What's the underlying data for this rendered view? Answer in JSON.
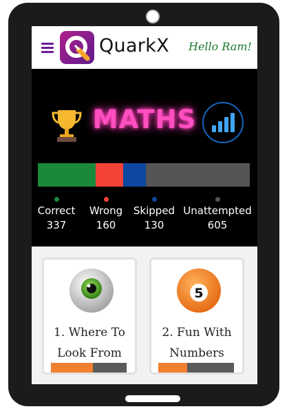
{
  "app": {
    "brand": "QuarkX",
    "greeting": "Hello Ram!",
    "menu_icon": "hamburger-menu-icon",
    "logo_icon": "quarkx-logo-icon"
  },
  "stats": {
    "subject": "MATHS",
    "trophy_icon": "trophy-icon",
    "chart_icon": "bar-chart-icon",
    "subject_color": "#ff4fc0",
    "items": [
      {
        "label": "Correct",
        "value": "337",
        "color": "#1a8a3a"
      },
      {
        "label": "Wrong",
        "value": "160",
        "color": "#f44336"
      },
      {
        "label": "Skipped",
        "value": "130",
        "color": "#0d47a1"
      },
      {
        "label": "Unattempted",
        "value": "605",
        "color": "#555555"
      }
    ]
  },
  "topics": [
    {
      "title": "1. Where To Look From",
      "icon": "eye-icon",
      "progress": 0.55
    },
    {
      "title": "2. Fun With Numbers",
      "icon": "pool-ball-5-icon",
      "ball_number": "5",
      "progress": 0.38
    }
  ],
  "colors": {
    "card_progress": "#f08030",
    "card_remaining": "#5a5a5a",
    "greeting": "#1b7a2e",
    "menu": "#6a1b9a"
  }
}
